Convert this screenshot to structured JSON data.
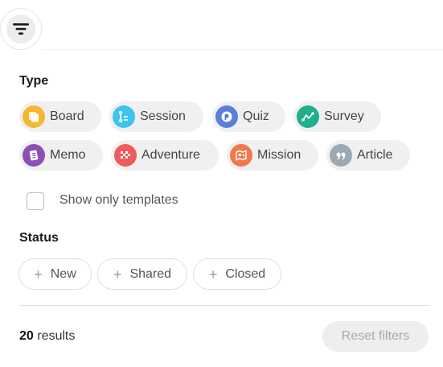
{
  "filter_button": {
    "icon": "filter-icon"
  },
  "type_section": {
    "title": "Type",
    "chips": [
      {
        "label": "Board",
        "icon": "board-icon",
        "color": "#F5B731"
      },
      {
        "label": "Session",
        "icon": "session-icon",
        "color": "#3BC4EE"
      },
      {
        "label": "Quiz",
        "icon": "quiz-icon",
        "color": "#5B7FDB"
      },
      {
        "label": "Survey",
        "icon": "survey-icon",
        "color": "#1FAF8E"
      },
      {
        "label": "Memo",
        "icon": "memo-icon",
        "color": "#8B4FB6"
      },
      {
        "label": "Adventure",
        "icon": "adventure-icon",
        "color": "#EF5B5B"
      },
      {
        "label": "Mission",
        "icon": "mission-icon",
        "color": "#F2774A"
      },
      {
        "label": "Article",
        "icon": "article-icon",
        "color": "#9AAAB4"
      }
    ]
  },
  "templates_checkbox": {
    "label": "Show only templates",
    "checked": false
  },
  "status_section": {
    "title": "Status",
    "chips": [
      {
        "label": "New"
      },
      {
        "label": "Shared"
      },
      {
        "label": "Closed"
      }
    ]
  },
  "footer": {
    "results_count": "20",
    "results_label": "results",
    "reset_label": "Reset filters"
  }
}
